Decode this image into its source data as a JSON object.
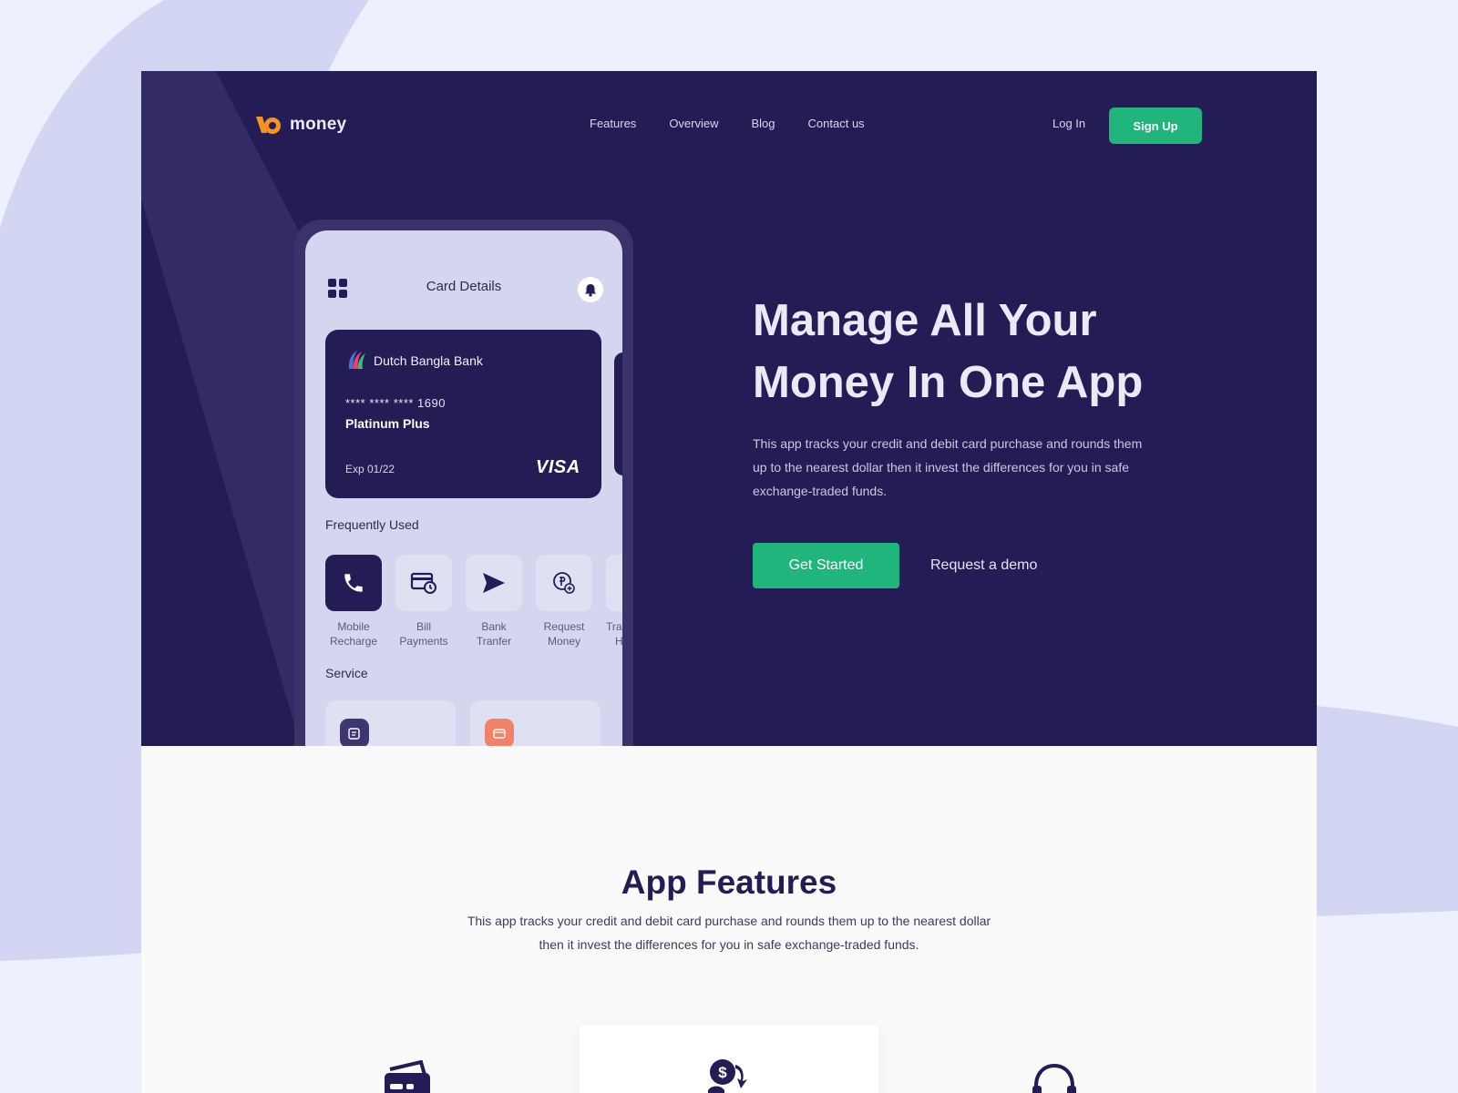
{
  "brand": {
    "name": "money",
    "accent": "#f7931e"
  },
  "colors": {
    "primary": "#241c55",
    "green": "#1fb57d",
    "background": "#eef0fe"
  },
  "nav": {
    "links": [
      "Features",
      "Overview",
      "Blog",
      "Contact us"
    ],
    "login": "Log In",
    "signup": "Sign Up"
  },
  "phone": {
    "title": "Card Details",
    "menu_icon": "grid-icon",
    "notification_icon": "bell-icon",
    "card": {
      "bank_name": "Dutch Bangla Bank",
      "number": "**** ****  **** 1690",
      "tier": "Platinum Plus",
      "expiry": "Exp 01/22",
      "network": "VISA"
    },
    "frequently_used": {
      "title": "Frequently Used",
      "items": [
        {
          "line1": "Mobile",
          "line2": "Recharge",
          "icon": "phone-icon"
        },
        {
          "line1": "Bill",
          "line2": "Payments",
          "icon": "bill-icon"
        },
        {
          "line1": "Bank",
          "line2": "Tranfer",
          "icon": "send-icon"
        },
        {
          "line1": "Request",
          "line2": "Money",
          "icon": "request-money-icon"
        },
        {
          "line1": "Tra",
          "line2": "H",
          "icon": ""
        }
      ]
    },
    "service": {
      "title": "Service"
    }
  },
  "hero": {
    "title_line1": "Manage All Your",
    "title_line2": "Money In One App",
    "description": "This app tracks your credit and debit card purchase and rounds them up to the nearest dollar then it invest the differences for you in safe exchange-traded funds.",
    "cta_primary": "Get Started",
    "cta_secondary": "Request a demo"
  },
  "features": {
    "title": "App Features",
    "description": "This app tracks your credit and debit card purchase and rounds them up to the nearest dollar then it invest the differences for you in safe exchange-traded funds.",
    "icons": [
      "cards-icon",
      "dollar-transfer-icon",
      "headset-icon"
    ]
  }
}
